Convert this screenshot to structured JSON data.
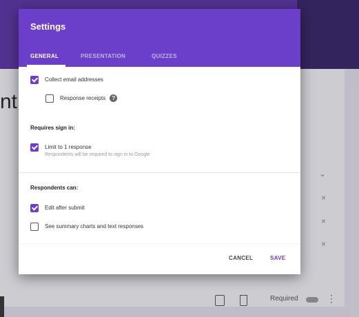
{
  "dialog": {
    "title": "Settings",
    "tabs": [
      {
        "label": "GENERAL",
        "active": true
      },
      {
        "label": "PRESENTATION",
        "active": false
      },
      {
        "label": "QUIZZES",
        "active": false
      }
    ],
    "collect_email": {
      "label": "Collect email addresses",
      "checked": true
    },
    "response_receipts": {
      "label": "Response receipts",
      "checked": false,
      "help_icon": "question-circle-icon"
    },
    "requires_signin": {
      "heading": "Requires sign in:",
      "limit_one": {
        "label": "Limit to 1 response",
        "sublabel": "Respondents will be required to sign in to Google",
        "checked": true
      }
    },
    "respondents_can": {
      "heading": "Respondents can:",
      "edit_after_submit": {
        "label": "Edit after submit",
        "checked": true
      },
      "see_summary": {
        "label": "See summary charts and text responses",
        "checked": false
      }
    },
    "cancel_label": "CANCEL",
    "save_label": "SAVE"
  },
  "background": {
    "title_fragment": "nt",
    "footer": {
      "required_label": "Required",
      "more_icon": "kebab-icon"
    }
  },
  "colors": {
    "accent": "#6b3fc9",
    "header": "#6b3fc9",
    "topbar": "#5e3aa6"
  }
}
